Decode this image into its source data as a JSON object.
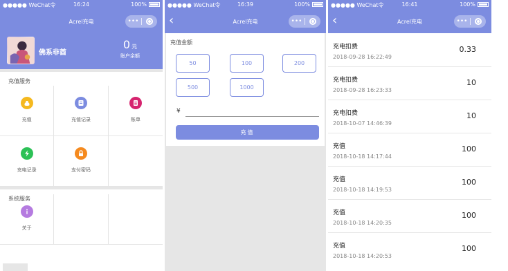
{
  "colors": {
    "accent": "#7c8ce0",
    "divider": "#e6e6e6"
  },
  "phone1": {
    "status": {
      "carrier": "●●●●● WeChat令",
      "time": "16:24",
      "battery": "100%"
    },
    "nav": {
      "title": "Acrel充电",
      "more_icon": "more-dots-icon",
      "close_icon": "capsule-target-icon"
    },
    "user": {
      "name": "佛系非酋",
      "avatar_icon": "user-avatar"
    },
    "balance": {
      "amount": "0",
      "unit": "元",
      "label": "账户余额"
    },
    "recharge_section": {
      "title": "充值服务",
      "items": [
        {
          "label": "充值",
          "icon": "money-bag-icon",
          "color": "#f5b91f"
        },
        {
          "label": "充值记录",
          "icon": "wallet-record-icon",
          "color": "#7c8ce0"
        },
        {
          "label": "账单",
          "icon": "bill-icon",
          "color": "#d6246f"
        },
        {
          "label": "充电记录",
          "icon": "lightning-icon",
          "color": "#2cc156"
        },
        {
          "label": "支付密码",
          "icon": "lock-icon",
          "color": "#f58a1f"
        }
      ]
    },
    "system_section": {
      "title": "系统服务",
      "items": [
        {
          "label": "关于",
          "icon": "info-icon",
          "color": "#b57be0"
        }
      ]
    }
  },
  "phone2": {
    "status": {
      "carrier": "●●●●● WeChat令",
      "time": "16:39",
      "battery": "100%"
    },
    "nav": {
      "title": "Acrel充电",
      "back_icon": "back-chevron-icon"
    },
    "form": {
      "caption": "充值金额",
      "amounts": [
        "50",
        "100",
        "200",
        "500",
        "1000"
      ],
      "currency": "¥",
      "submit": "充值"
    }
  },
  "phone3": {
    "status": {
      "carrier": "●●●●● WeChat令",
      "time": "16:41",
      "battery": "100%"
    },
    "nav": {
      "title": "Acrel充电",
      "back_icon": "back-chevron-icon"
    },
    "records": [
      {
        "title": "充电扣费",
        "date": "2018-09-28 16:22:49",
        "value": "0.33"
      },
      {
        "title": "充电扣费",
        "date": "2018-09-28 16:23:33",
        "value": "10"
      },
      {
        "title": "充电扣费",
        "date": "2018-10-07 14:46:39",
        "value": "10"
      },
      {
        "title": "充值",
        "date": "2018-10-18 14:17:44",
        "value": "100"
      },
      {
        "title": "充值",
        "date": "2018-10-18 14:19:53",
        "value": "100"
      },
      {
        "title": "充值",
        "date": "2018-10-18 14:20:35",
        "value": "100"
      },
      {
        "title": "充值",
        "date": "2018-10-18 14:20:53",
        "value": "100"
      }
    ]
  }
}
